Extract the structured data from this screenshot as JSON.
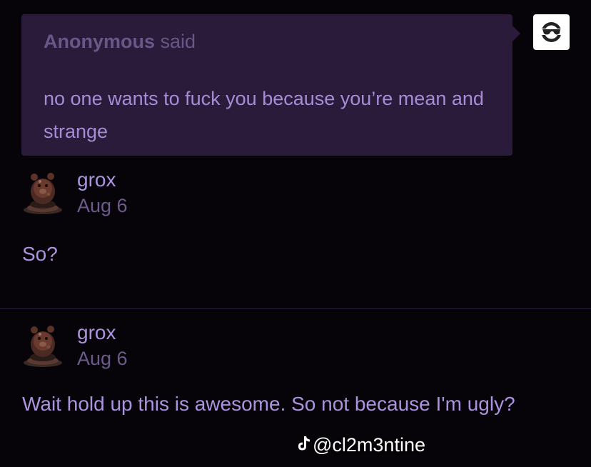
{
  "ask": {
    "asker_name": "Anonymous",
    "said_label": "said",
    "question": "no one wants to fuck you because you’re mean and strange",
    "asker_avatar_icon": "anon-sunglasses-icon"
  },
  "replies": [
    {
      "author": "grox",
      "date": "Aug 6",
      "body": "So?",
      "avatar_icon": "bear-figure-avatar"
    },
    {
      "author": "grox",
      "date": "Aug 6",
      "body": "Wait hold up this is awesome. So not because I'm ugly?",
      "avatar_icon": "bear-figure-avatar"
    }
  ],
  "watermark": {
    "handle": "@cl2m3ntine",
    "icon": "tiktok-icon"
  },
  "colors": {
    "background": "#060408",
    "bubble": "#2a1b3a",
    "accent_text": "#ab93e0",
    "muted_text": "#6c5a8c"
  }
}
